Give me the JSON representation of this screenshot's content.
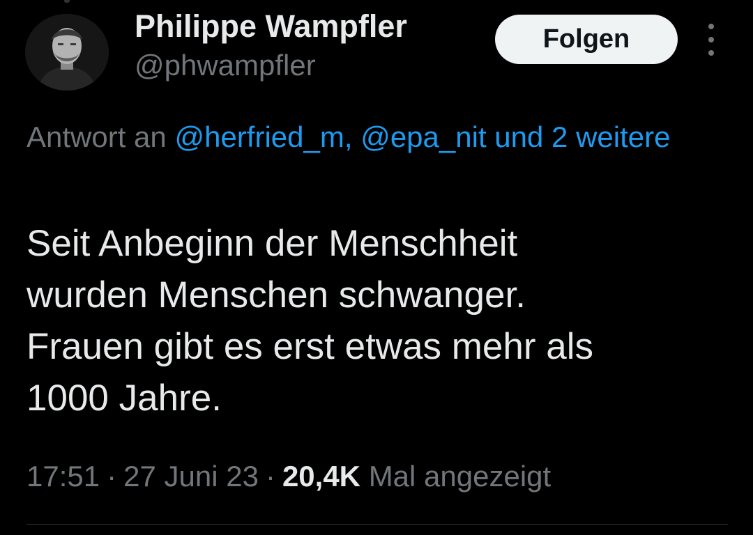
{
  "author": {
    "display_name": "Philippe Wampfler",
    "handle": "@phwampfler",
    "avatar_icon": "profile-photo"
  },
  "actions": {
    "follow_label": "Folgen",
    "more_icon": "more-vertical-icon"
  },
  "reply_context": {
    "prefix": "Antwort an ",
    "mention_1": "@herfried_m",
    "separator": ", ",
    "mention_2": "@epa_nit",
    "suffix": " und 2 weitere"
  },
  "tweet": {
    "lines": [
      "Seit Anbeginn der Menschheit",
      "wurden Menschen schwanger.",
      "Frauen gibt es erst etwas mehr als",
      "1000 Jahre."
    ]
  },
  "meta": {
    "time": "17:51",
    "dot_1": "·",
    "date": "27 Juni 23",
    "dot_2": "·",
    "views_count": "20,4K",
    "views_label": "Mal angezeigt"
  },
  "colors": {
    "background": "#000000",
    "primary_text": "#e7e9ea",
    "secondary_text": "#71767b",
    "link": "#1d9bf0",
    "button_bg": "#eff3f4",
    "button_text": "#0f1419",
    "divider": "#2f3336"
  }
}
